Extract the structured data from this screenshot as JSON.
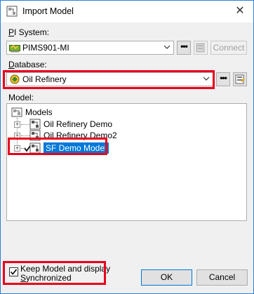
{
  "window": {
    "title": "Import Model",
    "close_glyph": "✕"
  },
  "pi_system": {
    "label_accel": "P",
    "label_rest": "I System:",
    "value": "PIMS901-MI",
    "more_button": "•••",
    "connect_button": "Connect"
  },
  "database": {
    "label_accel": "D",
    "label_rest": "atabase:",
    "value": "Oil Refinery",
    "more_button": "•••"
  },
  "model": {
    "label": "Model:",
    "tree": [
      {
        "label": "Models",
        "level": 0,
        "expander": "",
        "checked": false,
        "selected": false
      },
      {
        "label": "Oil Refinery Demo",
        "level": 1,
        "expander": "+",
        "checked": false,
        "selected": false
      },
      {
        "label": "Oil Refinery Demo2",
        "level": 1,
        "expander": "+",
        "checked": false,
        "selected": false
      },
      {
        "label": "SF Demo Model",
        "level": 1,
        "expander": "+",
        "checked": true,
        "selected": true
      }
    ]
  },
  "sync": {
    "checkbox_checked": true,
    "check_glyph": "✓",
    "label_line1": "Keep Model and display",
    "label_line2_accel": "S",
    "label_line2_rest": "ynchronized"
  },
  "buttons": {
    "ok": "OK",
    "cancel": "Cancel"
  },
  "colors": {
    "highlight_border": "#e8001c",
    "selection": "#0078d7",
    "window_border": "#2b7fd8"
  },
  "icons": {
    "title": "import-model-icon",
    "pi_system": "pi-server-icon",
    "database": "af-database-icon",
    "models_root": "models-folder-icon",
    "model_item": "model-icon"
  }
}
